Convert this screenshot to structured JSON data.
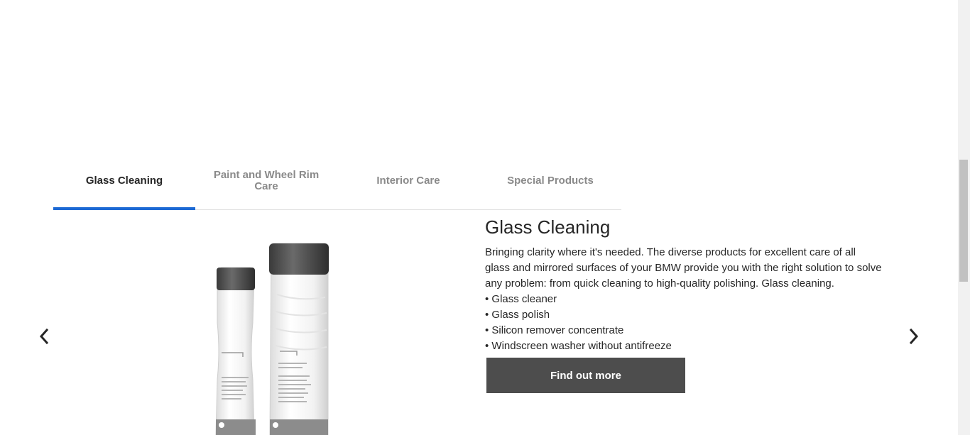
{
  "tabs": [
    {
      "label": "Glass Cleaning",
      "active": true
    },
    {
      "label": "Paint and Wheel Rim Care",
      "active": false
    },
    {
      "label": "Interior Care",
      "active": false
    },
    {
      "label": "Special Products",
      "active": false
    }
  ],
  "content": {
    "title": "Glass Cleaning",
    "description": "Bringing clarity where it's needed. The diverse products for excellent care of all glass and mirrored surfaces of your BMW provide you with the right solution to solve any problem: from quick cleaning to high-quality polishing. Glass cleaning.",
    "items": [
      "• Glass cleaner",
      "• Glass polish",
      "• Silicon remover concentrate",
      "• Windscreen washer without antifreeze"
    ],
    "cta_label": "Find out more"
  },
  "navigation": {
    "prev_icon": "chevron-left-icon",
    "next_icon": "chevron-right-icon"
  },
  "colors": {
    "accent": "#1c69d4",
    "button_bg": "#4d4d4d",
    "tab_inactive": "#8a8a8a"
  }
}
